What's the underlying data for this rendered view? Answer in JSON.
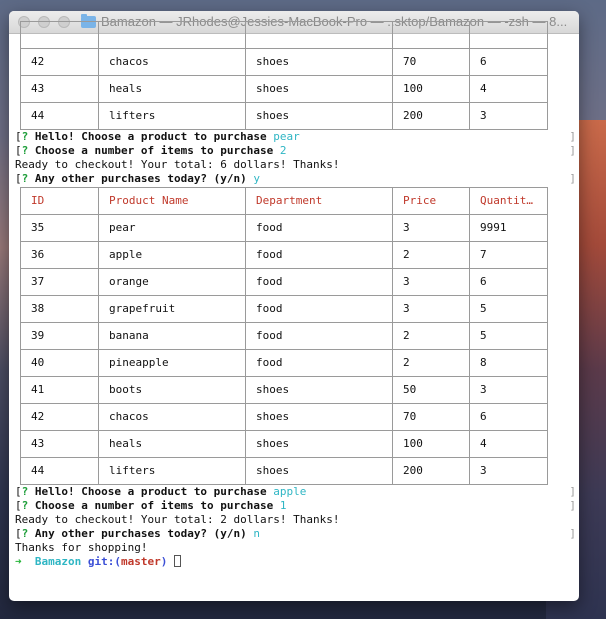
{
  "window": {
    "title": "Bamazon — JRhodes@Jessies-MacBook-Pro — ..sktop/Bamazon — -zsh — 8..."
  },
  "first_table_rows": [
    [
      "",
      "",
      "",
      "",
      ""
    ],
    [
      "42",
      "chacos",
      "shoes",
      "70",
      "6"
    ],
    [
      "43",
      "heals",
      "shoes",
      "100",
      "4"
    ],
    [
      "44",
      "lifters",
      "shoes",
      "200",
      "3"
    ]
  ],
  "session1": {
    "q1_prefix": "[",
    "q1_mark": "?",
    "q1_text": " Hello! Choose a product to purchase ",
    "q1_answer": "pear",
    "q2_prefix": "[",
    "q2_mark": "?",
    "q2_text": " Choose a number of items to purchase ",
    "q2_answer": "2",
    "checkout": "Ready to checkout! Your total: 6 dollars! Thanks!",
    "q3_prefix": "[",
    "q3_mark": "?",
    "q3_text": " Any other purchases today? (y/n) ",
    "q3_answer": "y",
    "right_bracket": "]"
  },
  "table": {
    "headers": [
      "ID",
      "Product Name",
      "Department",
      "Price",
      "Quantit…"
    ],
    "rows": [
      [
        "35",
        "pear",
        "food",
        "3",
        "9991"
      ],
      [
        "36",
        "apple",
        "food",
        "2",
        "7"
      ],
      [
        "37",
        "orange",
        "food",
        "3",
        "6"
      ],
      [
        "38",
        "grapefruit",
        "food",
        "3",
        "5"
      ],
      [
        "39",
        "banana",
        "food",
        "2",
        "5"
      ],
      [
        "40",
        "pineapple",
        "food",
        "2",
        "8"
      ],
      [
        "41",
        "boots",
        "shoes",
        "50",
        "3"
      ],
      [
        "42",
        "chacos",
        "shoes",
        "70",
        "6"
      ],
      [
        "43",
        "heals",
        "shoes",
        "100",
        "4"
      ],
      [
        "44",
        "lifters",
        "shoes",
        "200",
        "3"
      ]
    ]
  },
  "session2": {
    "q1_prefix": "[",
    "q1_mark": "?",
    "q1_text": " Hello! Choose a product to purchase ",
    "q1_answer": "apple",
    "q2_prefix": "[",
    "q2_mark": "?",
    "q2_text": " Choose a number of items to purchase ",
    "q2_answer": "1",
    "checkout": "Ready to checkout! Your total: 2 dollars! Thanks!",
    "q3_prefix": "[",
    "q3_mark": "?",
    "q3_text": " Any other purchases today? (y/n) ",
    "q3_answer": "n",
    "thanks": "Thanks for shopping!",
    "right_bracket": "]"
  },
  "prompt": {
    "arrow": "➜",
    "dir": "Bamazon",
    "git": "git:(",
    "branch": "master",
    "git_close": ")"
  },
  "colors": {
    "header_red": "#c0392b",
    "answer_cyan": "#2fb6c4",
    "question_green": "#1e9e3a"
  }
}
